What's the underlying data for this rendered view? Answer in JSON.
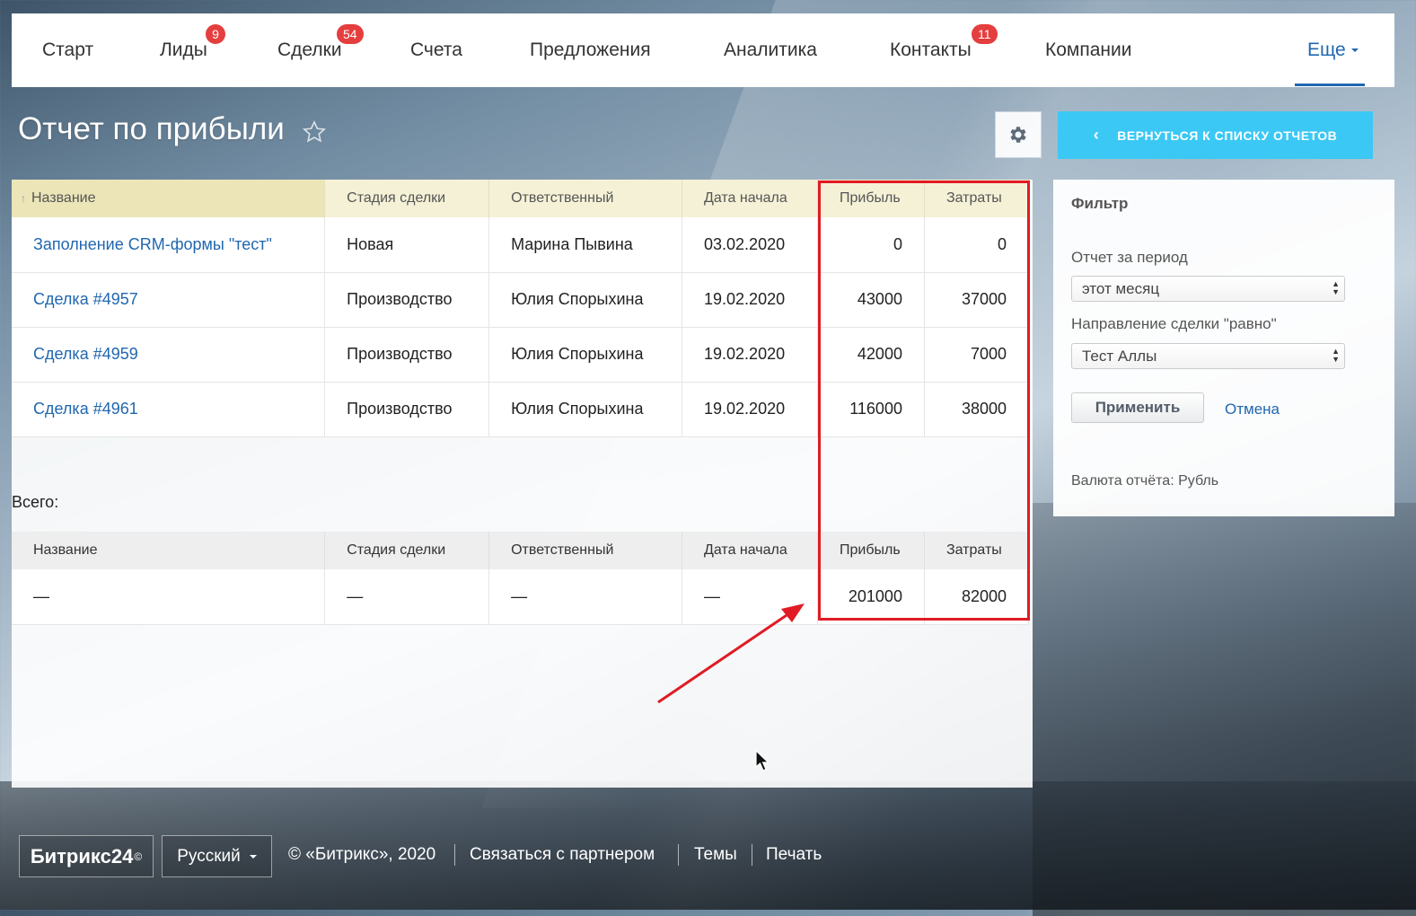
{
  "nav": {
    "items": [
      {
        "label": "Старт",
        "badge": ""
      },
      {
        "label": "Лиды",
        "badge": "9"
      },
      {
        "label": "Сделки",
        "badge": "54"
      },
      {
        "label": "Счета",
        "badge": ""
      },
      {
        "label": "Предложения",
        "badge": ""
      },
      {
        "label": "Аналитика",
        "badge": ""
      },
      {
        "label": "Контакты",
        "badge": "11"
      },
      {
        "label": "Компании",
        "badge": ""
      }
    ],
    "more_label": "Еще"
  },
  "page": {
    "title": "Отчет по прибыли",
    "back_button": "ВЕРНУТЬСЯ К СПИСКУ ОТЧЕТОВ"
  },
  "report": {
    "columns": [
      "Название",
      "Стадия сделки",
      "Ответственный",
      "Дата начала",
      "Прибыль",
      "Затраты"
    ],
    "rows": [
      {
        "name": "Заполнение CRM-формы \"тест\"",
        "stage": "Новая",
        "responsible": "Марина Пывина",
        "date": "03.02.2020",
        "profit": "0",
        "costs": "0"
      },
      {
        "name": "Сделка #4957",
        "stage": "Производство",
        "responsible": "Юлия Спорыхина",
        "date": "19.02.2020",
        "profit": "43000",
        "costs": "37000"
      },
      {
        "name": "Сделка #4959",
        "stage": "Производство",
        "responsible": "Юлия Спорыхина",
        "date": "19.02.2020",
        "profit": "42000",
        "costs": "7000"
      },
      {
        "name": "Сделка #4961",
        "stage": "Производство",
        "responsible": "Юлия Спорыхина",
        "date": "19.02.2020",
        "profit": "116000",
        "costs": "38000"
      }
    ],
    "total_label": "Всего:",
    "total_row": {
      "name": "—",
      "stage": "—",
      "responsible": "—",
      "date": "—",
      "profit": "201000",
      "costs": "82000"
    }
  },
  "filter": {
    "title": "Фильтр",
    "period_label": "Отчет за период",
    "period_value": "этот месяц",
    "direction_label": "Направление сделки \"равно\"",
    "direction_value": "Тест Аллы",
    "apply_label": "Применить",
    "cancel_label": "Отмена",
    "currency_text": "Валюта отчёта: Рубль"
  },
  "footer": {
    "logo": "Битрикс24",
    "logo_mark": "©",
    "language": "Русский",
    "copyright": "© «Битрикс», 2020",
    "links": [
      "Связаться с партнером",
      "Темы",
      "Печать"
    ]
  },
  "colors": {
    "accent_blue": "#2067b0",
    "back_button": "#3bc8f5",
    "badge_red": "#e53e3e",
    "highlight_red": "#e01b24"
  }
}
